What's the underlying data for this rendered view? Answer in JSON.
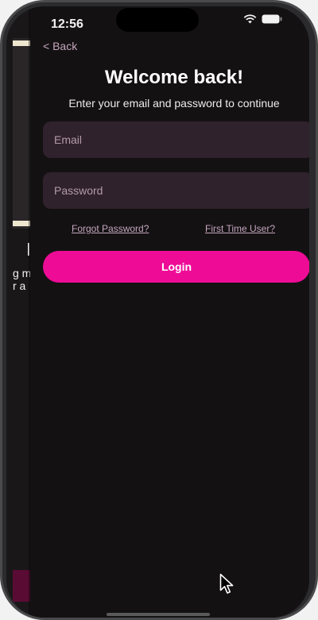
{
  "status_bar": {
    "time": "12:56",
    "icons": [
      "wifi-icon",
      "battery-icon"
    ]
  },
  "previous_screen": {
    "text": "g m\nr a"
  },
  "nav": {
    "back_label": "< Back"
  },
  "header": {
    "title": "Welcome back!",
    "subtitle": "Enter your email and password to continue"
  },
  "form": {
    "email": {
      "value": "",
      "placeholder": "Email"
    },
    "password": {
      "value": "",
      "placeholder": "Password"
    },
    "forgot_password_label": "Forgot Password?",
    "first_time_label": "First Time User?",
    "login_label": "Login"
  },
  "colors": {
    "background": "#141113",
    "field": "#30222c",
    "accent": "#ee0c96",
    "link": "#c4a6bd"
  }
}
